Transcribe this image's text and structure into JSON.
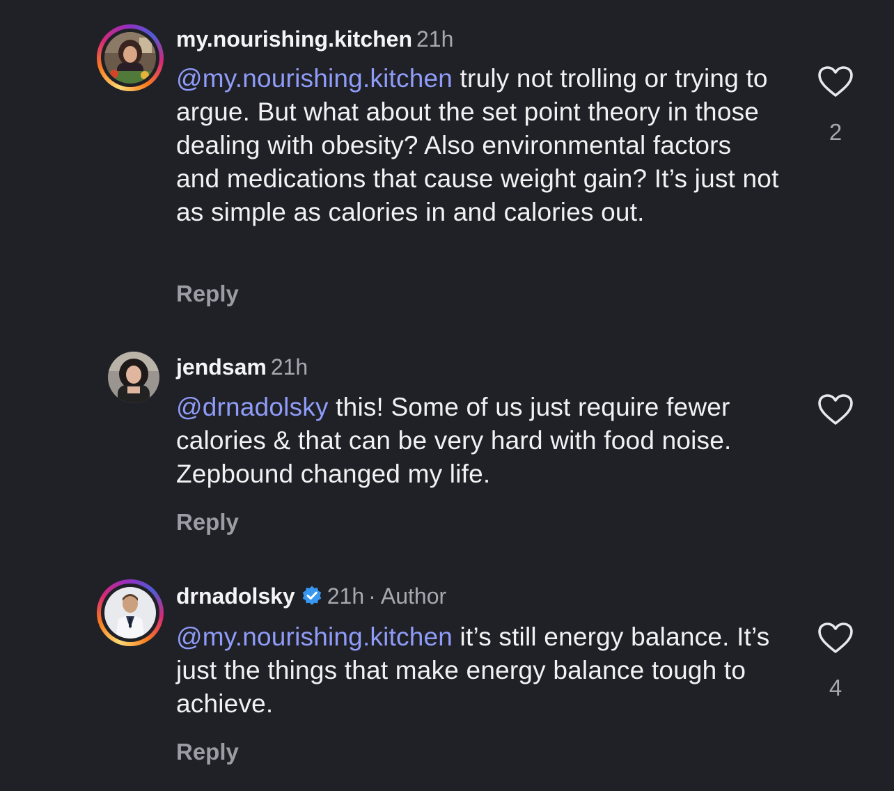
{
  "comments": [
    {
      "username": "my.nourishing.kitchen",
      "time": "21h",
      "author_tag": "",
      "mention": "@my.nourishing.kitchen",
      "text": " truly not trolling or trying to argue.  But what about the set point theory in those dealing with obesity? Also environmental factors and medications that cause weight gain?  It’s just not as simple as calories in and calories out.",
      "reply_label": "Reply",
      "like_count": "2",
      "has_story_ring": true,
      "verified": false
    },
    {
      "username": "jendsam",
      "time": "21h",
      "author_tag": "",
      "mention": "@drnadolsky",
      "text": " this! Some of us just require fewer calories & that can be very hard with food noise. Zepbound changed my life.",
      "reply_label": "Reply",
      "like_count": "",
      "has_story_ring": false,
      "verified": false
    },
    {
      "username": "drnadolsky",
      "time": "21h",
      "author_tag": "· Author",
      "mention": "@my.nourishing.kitchen",
      "text": " it’s still energy balance. It’s just the things that make energy balance tough to achieve.",
      "reply_label": "Reply",
      "like_count": "4",
      "has_story_ring": true,
      "verified": true
    }
  ],
  "icons": {
    "like": "heart-outline-icon",
    "verified": "verified-badge-icon"
  },
  "colors": {
    "background": "#202127",
    "mention": "#8f9cf8",
    "secondary_text": "#a8a9b0",
    "verified_blue": "#3897f0"
  }
}
